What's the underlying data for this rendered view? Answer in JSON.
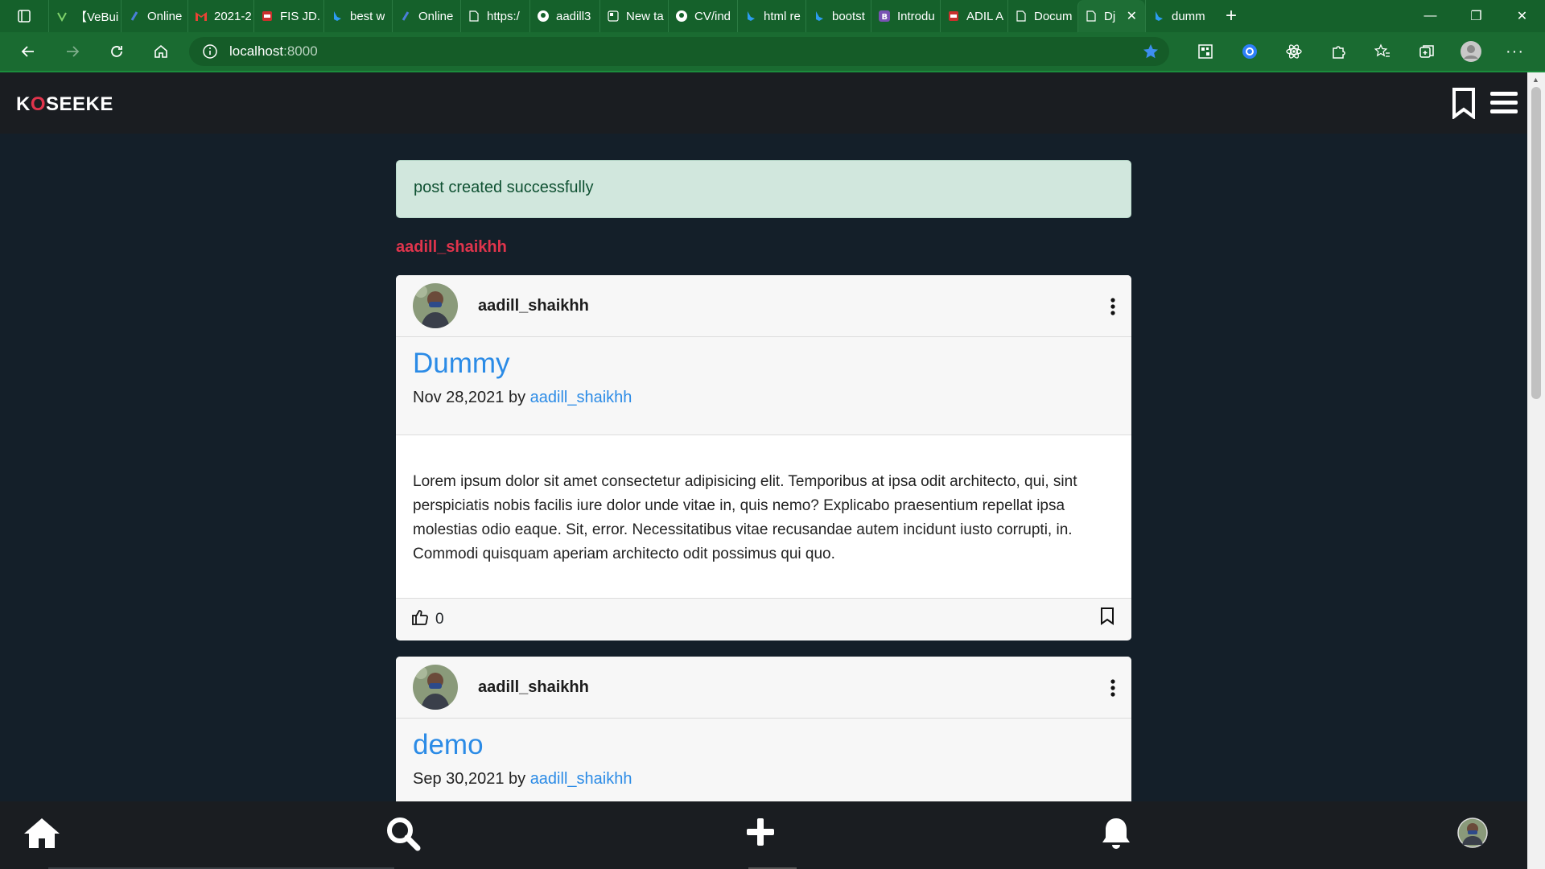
{
  "tabs": [
    {
      "title": "【VeBui",
      "icon": "vebuild-icon"
    },
    {
      "title": "Online",
      "icon": "online-icon"
    },
    {
      "title": "2021-2",
      "icon": "gmail-icon"
    },
    {
      "title": "FIS JD.",
      "icon": "pdf-icon"
    },
    {
      "title": "best w",
      "icon": "bing-icon"
    },
    {
      "title": "Online",
      "icon": "online-icon"
    },
    {
      "title": "https:/",
      "icon": "page-icon"
    },
    {
      "title": "aadill3",
      "icon": "github-icon"
    },
    {
      "title": "New ta",
      "icon": "newtab-icon"
    },
    {
      "title": "CV/ind",
      "icon": "github-icon"
    },
    {
      "title": "html re",
      "icon": "bing-icon"
    },
    {
      "title": "bootst",
      "icon": "bing-icon"
    },
    {
      "title": "Introdu",
      "icon": "bootstrap-icon"
    },
    {
      "title": "ADIL A",
      "icon": "pdf-icon"
    },
    {
      "title": "Docum",
      "icon": "page-icon"
    },
    {
      "title": "Dj",
      "icon": "page-icon"
    },
    {
      "title": "dumm",
      "icon": "bing-icon"
    }
  ],
  "active_tab_index": 15,
  "address": {
    "host": "localhost",
    "port": ":8000"
  },
  "site": {
    "brand_k": "K",
    "brand_o": "O",
    "brand_rest": "SEEKE"
  },
  "alert": "post created successfully",
  "profile_user": "aadill_shaikhh",
  "posts": [
    {
      "author": "aadill_shaikhh",
      "title": "Dummy",
      "date": "Nov 28,2021",
      "by": "by",
      "by_author": "aadill_shaikhh",
      "body": "Lorem ipsum dolor sit amet consectetur adipisicing elit. Temporibus at ipsa odit architecto, qui, sint perspiciatis nobis facilis iure dolor unde vitae in, quis nemo? Explicabo praesentium repellat ipsa molestias odio eaque. Sit, error. Necessitatibus vitae recusandae autem incidunt iusto corrupti, in. Commodi quisquam aperiam architecto odit possimus qui quo.",
      "likes": "0"
    },
    {
      "author": "aadill_shaikhh",
      "title": "demo",
      "date": "Sep 30,2021",
      "by": "by",
      "by_author": "aadill_shaikhh"
    }
  ],
  "colors": {
    "accent": "#2b8be6",
    "brand_red": "#e0344c",
    "chrome_green": "#15612b"
  }
}
